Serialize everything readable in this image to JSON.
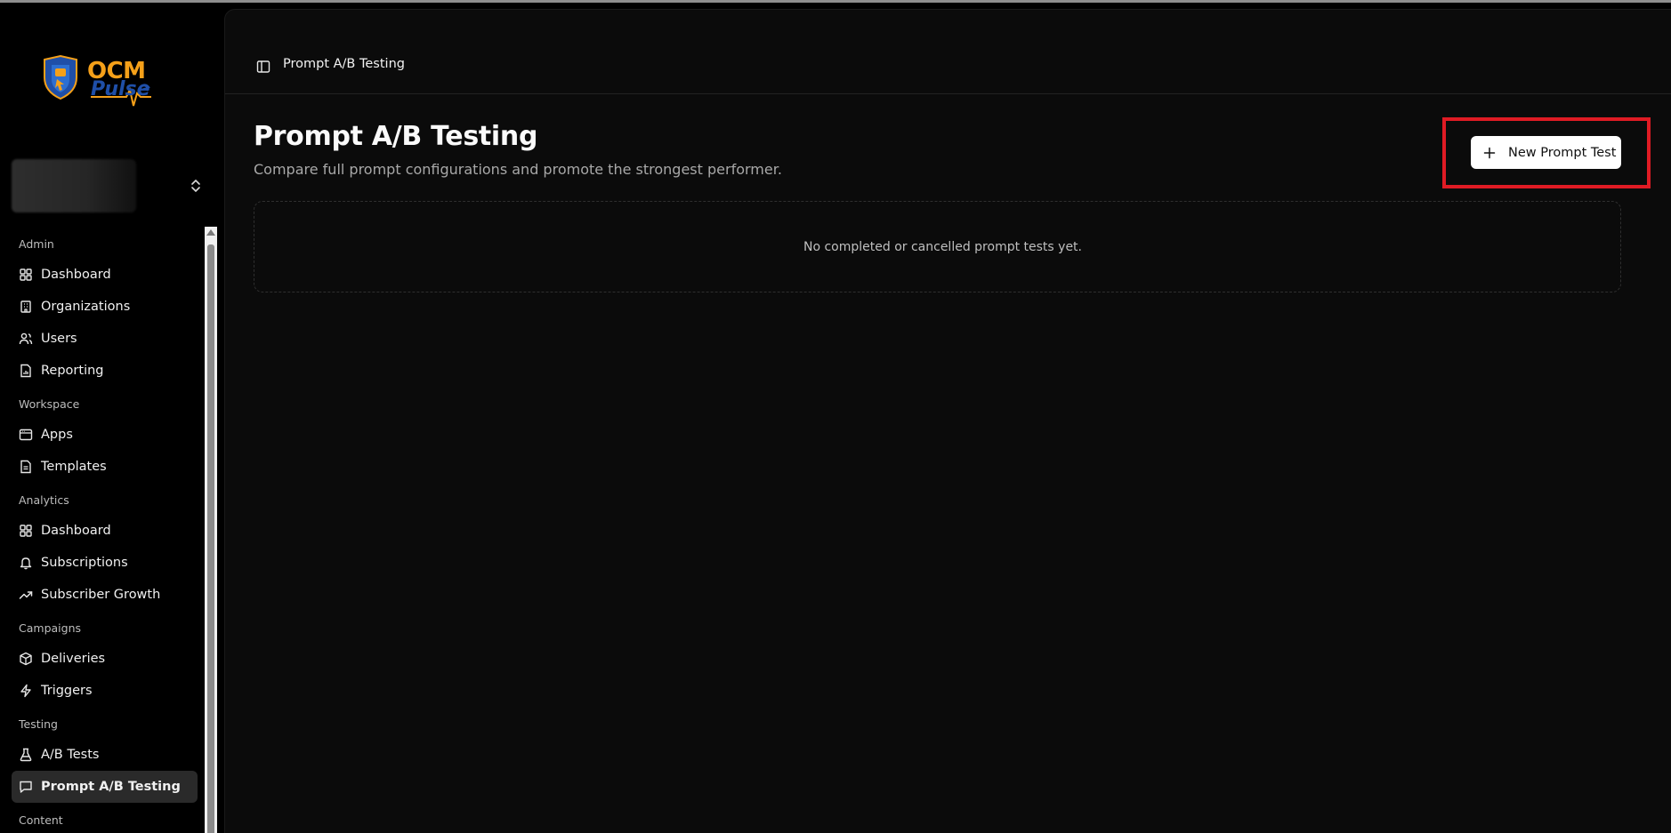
{
  "app": {
    "brand_line1": "OCM",
    "brand_line2": "Pulse"
  },
  "breadcrumb": {
    "current": "Prompt A/B Testing"
  },
  "page": {
    "title": "Prompt A/B Testing",
    "subtitle": "Compare full prompt configurations and promote the strongest performer.",
    "new_button_label": "New Prompt Test",
    "empty_message": "No completed or cancelled prompt tests yet."
  },
  "nav": {
    "sections": [
      {
        "title": "Admin",
        "items": [
          {
            "label": "Dashboard",
            "icon": "grid-icon"
          },
          {
            "label": "Organizations",
            "icon": "building-icon"
          },
          {
            "label": "Users",
            "icon": "users-icon"
          },
          {
            "label": "Reporting",
            "icon": "report-icon"
          }
        ]
      },
      {
        "title": "Workspace",
        "items": [
          {
            "label": "Apps",
            "icon": "app-window-icon"
          },
          {
            "label": "Templates",
            "icon": "document-icon"
          }
        ]
      },
      {
        "title": "Analytics",
        "items": [
          {
            "label": "Dashboard",
            "icon": "grid-icon"
          },
          {
            "label": "Subscriptions",
            "icon": "bell-icon"
          },
          {
            "label": "Subscriber Growth",
            "icon": "trending-up-icon"
          }
        ]
      },
      {
        "title": "Campaigns",
        "items": [
          {
            "label": "Deliveries",
            "icon": "package-icon"
          },
          {
            "label": "Triggers",
            "icon": "zap-icon"
          }
        ]
      },
      {
        "title": "Testing",
        "items": [
          {
            "label": "A/B Tests",
            "icon": "flask-icon"
          },
          {
            "label": "Prompt A/B Testing",
            "icon": "message-icon",
            "active": true
          }
        ]
      },
      {
        "title": "Content",
        "items": []
      }
    ]
  },
  "colors": {
    "accent_orange": "#f5a019",
    "accent_blue": "#1f4fa8",
    "highlight_red": "#e01b24"
  }
}
